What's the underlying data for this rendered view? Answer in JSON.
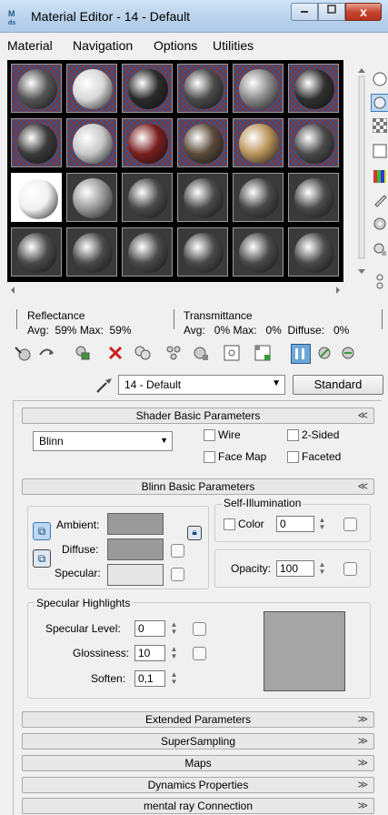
{
  "window": {
    "title": "Material Editor - 14 - Default",
    "controls": {
      "minimize": "–",
      "maximize": "□",
      "close": "x"
    }
  },
  "menubar": [
    "Material",
    "Navigation",
    "Options",
    "Utilities"
  ],
  "slots": {
    "rows": 4,
    "cols": 6,
    "selected": {
      "row": 2,
      "col": 0
    },
    "colors": [
      "#555555",
      "#d8d8d8",
      "#2a2a2a",
      "#4a4a4a",
      "#8a8a8a",
      "#303030",
      "#3a3a3a",
      "#c8c8c8",
      "#7a1e1e",
      "#5a4a3a",
      "#b8935a",
      "#4a4a4a",
      "#f0f0f0",
      "#9a9a9a",
      "#4a4a4a",
      "#4a4a4a",
      "#4a4a4a",
      "#4a4a4a",
      "#4a4a4a",
      "#4a4a4a",
      "#4a4a4a",
      "#4a4a4a",
      "#4a4a4a",
      "#4a4a4a"
    ]
  },
  "info": {
    "reflectance_label": "Reflectance",
    "reflectance_values": "Avg:  59% Max:  59%",
    "transmittance_label": "Transmittance",
    "transmittance_values": "Avg:   0% Max:   0%  Diffuse:   0%"
  },
  "material_name": "14 - Default",
  "material_type": "Standard",
  "shader_basic": {
    "title": "Shader Basic Parameters",
    "shader": "Blinn",
    "wire": "Wire",
    "two_sided": "2-Sided",
    "face_map": "Face Map",
    "faceted": "Faceted"
  },
  "blinn_basic": {
    "title": "Blinn Basic Parameters",
    "self_illum_title": "Self-Illumination",
    "ambient_label": "Ambient:",
    "diffuse_label": "Diffuse:",
    "specular_label": "Specular:",
    "color_label": "Color",
    "color_value": "0",
    "opacity_label": "Opacity:",
    "opacity_value": "100",
    "ambient_color": "#9a9a9a",
    "diffuse_color": "#9a9a9a",
    "specular_color": "#e6e6e6"
  },
  "specular_highlights": {
    "title": "Specular Highlights",
    "spec_level_label": "Specular Level:",
    "spec_level_value": "0",
    "glossiness_label": "Glossiness:",
    "glossiness_value": "10",
    "soften_label": "Soften:",
    "soften_value": "0,1",
    "curve_color": "#a5a5a5"
  },
  "rollouts": [
    "Extended Parameters",
    "SuperSampling",
    "Maps",
    "Dynamics Properties",
    "mental ray Connection"
  ],
  "chevron_up": "≪",
  "chevron_down": "≫"
}
